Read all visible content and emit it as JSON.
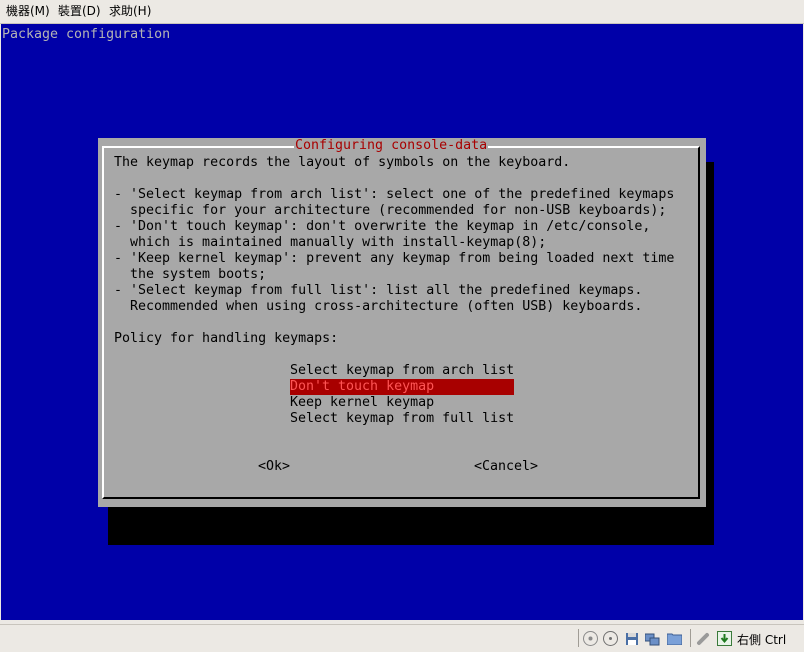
{
  "menubar": {
    "items": [
      {
        "label": "機器(M)"
      },
      {
        "label": "裝置(D)"
      },
      {
        "label": "求助(H)"
      }
    ]
  },
  "console": {
    "screen_title": "Package configuration",
    "dialog": {
      "title": "Configuring console-data",
      "intro": "The keymap records the layout of symbols on the keyboard.",
      "bullets": [
        "- 'Select keymap from arch list': select one of the predefined keymaps",
        "  specific for your architecture (recommended for non-USB keyboards);",
        "- 'Don't touch keymap': don't overwrite the keymap in /etc/console,",
        "  which is maintained manually with install-keymap(8);",
        "- 'Keep kernel keymap': prevent any keymap from being loaded next time",
        "  the system boots;",
        "- 'Select keymap from full list': list all the predefined keymaps.",
        "  Recommended when using cross-architecture (often USB) keyboards."
      ],
      "prompt": "Policy for handling keymaps:",
      "options": [
        {
          "label": "Select keymap from arch list",
          "selected": false
        },
        {
          "label": "Don't touch keymap",
          "selected": true
        },
        {
          "label": "Keep kernel keymap",
          "selected": false
        },
        {
          "label": "Select keymap from full list",
          "selected": false
        }
      ],
      "ok_label": "<Ok>",
      "cancel_label": "<Cancel>"
    },
    "colors": {
      "background": "#0000a8",
      "dialog": "#a8a8a8",
      "title_text": "#a80000",
      "selection_bg": "#a80000",
      "selection_text": "#ff5555"
    }
  },
  "statusbar": {
    "icons": [
      "harddisk-icon",
      "cdrom-icon",
      "floppy-icon",
      "network-icon",
      "shared-folder-icon",
      "usb-icon",
      "mouse-integration-icon"
    ],
    "host_key": "右側 Ctrl"
  }
}
